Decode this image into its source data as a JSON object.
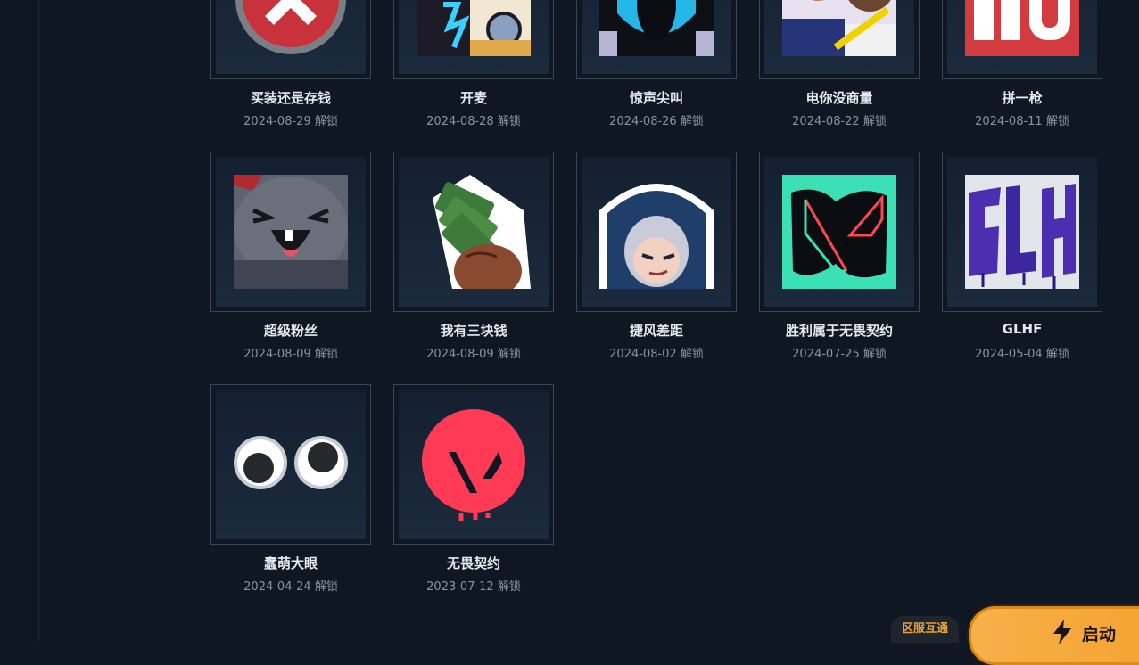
{
  "sprays": [
    {
      "name": "买装还是存钱",
      "date": "2024-08-29 解锁"
    },
    {
      "name": "开麦",
      "date": "2024-08-28 解锁"
    },
    {
      "name": "惊声尖叫",
      "date": "2024-08-26 解锁"
    },
    {
      "name": "电你没商量",
      "date": "2024-08-22 解锁"
    },
    {
      "name": "拼一枪",
      "date": "2024-08-11 解锁"
    },
    {
      "name": "超级粉丝",
      "date": "2024-08-09 解锁"
    },
    {
      "name": "我有三块钱",
      "date": "2024-08-09 解锁"
    },
    {
      "name": "捷风差距",
      "date": "2024-08-02 解锁"
    },
    {
      "name": "胜利属于无畏契约",
      "date": "2024-07-25 解锁"
    },
    {
      "name": "GLHF",
      "date": "2024-05-04 解锁"
    },
    {
      "name": "蠢萌大眼",
      "date": "2024-04-24 解锁"
    },
    {
      "name": "无畏契约",
      "date": "2023-07-12 解锁"
    }
  ],
  "footer": {
    "region_label": "区服互通",
    "launch_label": "启动",
    "launch_icon": "lightning-bolt-icon"
  },
  "colors": {
    "background": "#0f1822",
    "accent": "#f4a431",
    "region_text": "#e8a23a"
  }
}
